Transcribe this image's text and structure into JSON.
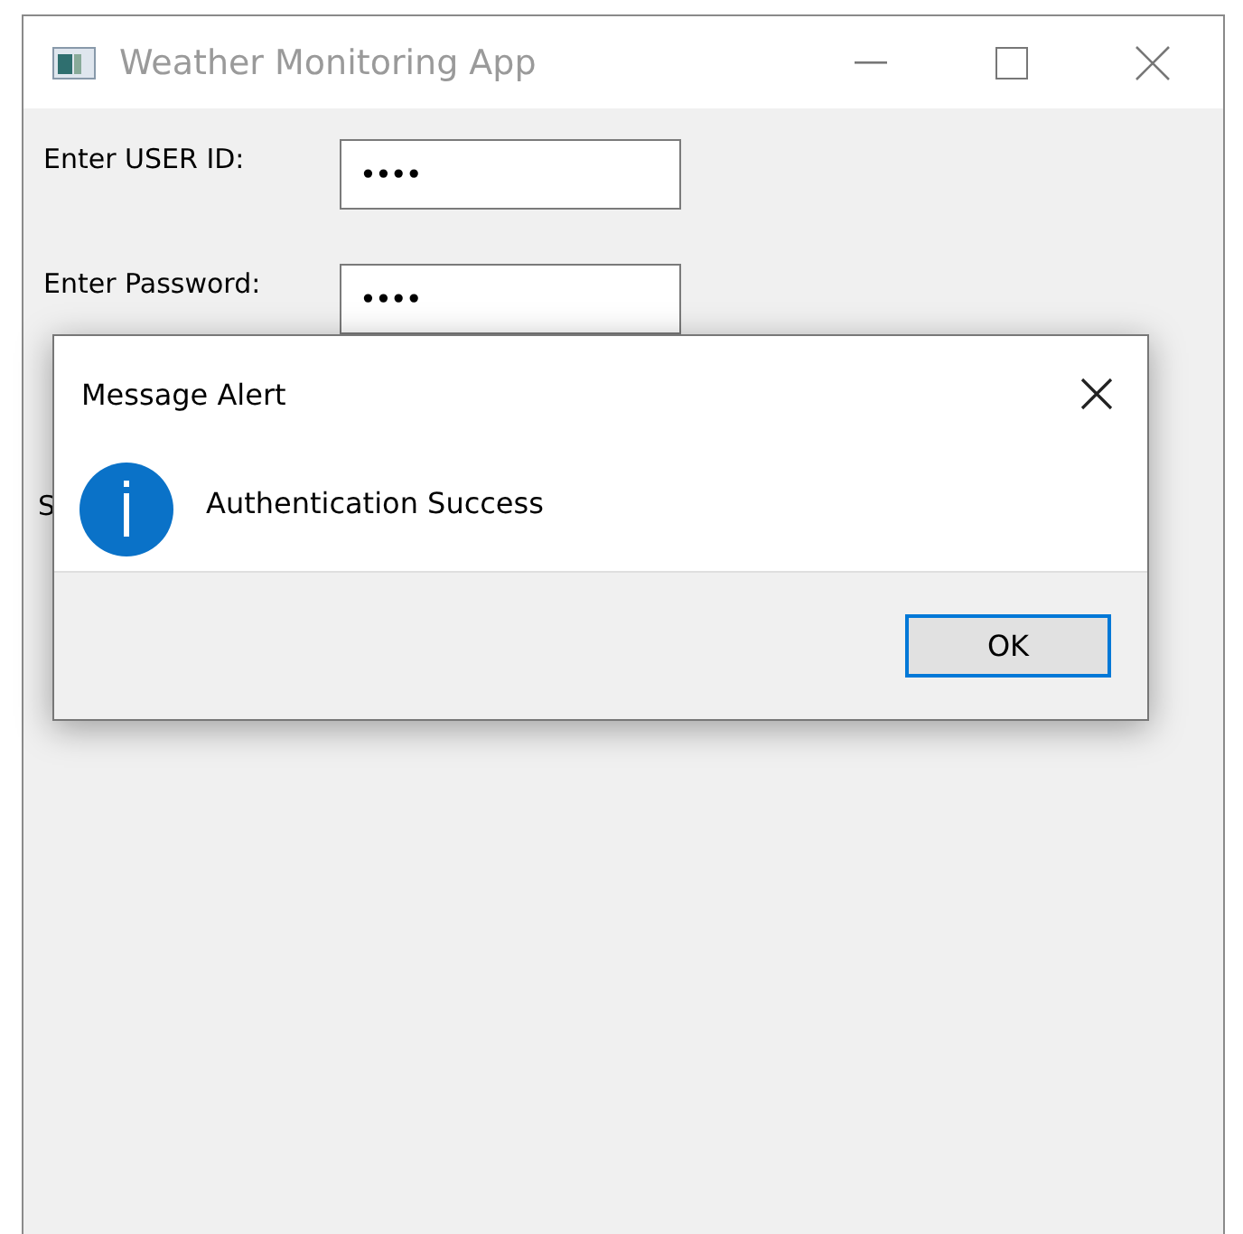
{
  "window": {
    "title": "Weather Monitoring App"
  },
  "fields": [
    {
      "label": "Enter USER ID:",
      "value": "••••"
    },
    {
      "label": "Enter Password:",
      "value": "••••"
    }
  ],
  "hidden_label": "S",
  "dialog": {
    "title": "Message Alert",
    "message": "Authentication Success",
    "buttons": [
      {
        "label": "OK",
        "selected": true
      }
    ]
  }
}
